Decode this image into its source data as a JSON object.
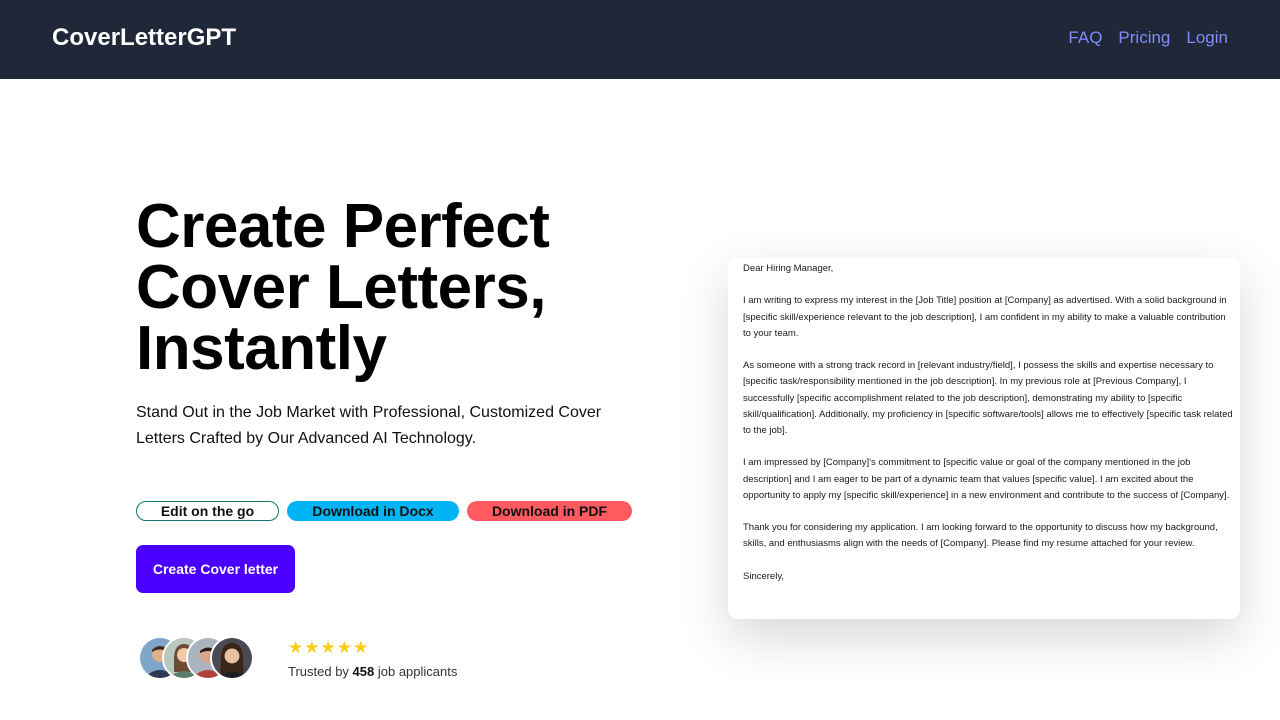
{
  "navbar": {
    "brand": "CoverLetterGPT",
    "links": [
      "FAQ",
      "Pricing",
      "Login"
    ]
  },
  "hero": {
    "title_lines": [
      "Create Perfect",
      "Cover Letters,",
      "Instantly"
    ],
    "subtitle": "Stand Out in the Job Market with Professional, Customized Cover Letters Crafted by Our Advanced AI Technology.",
    "pills": [
      "Edit on the go",
      "Download in Docx",
      "Download in PDF"
    ],
    "cta_label": "Create Cover letter",
    "rating": {
      "stars": 5,
      "trusted_prefix": "Trusted by ",
      "count": "458",
      "trusted_suffix": " job applicants"
    }
  },
  "letter": {
    "paragraphs": [
      "Dear Hiring Manager,",
      "I am writing to express my interest in the [Job Title] position at [Company] as advertised. With a solid background in [specific skill/experience relevant to the job description], I am confident in my ability to make a valuable contribution to your team.",
      "As someone with a strong track record in [relevant industry/field], I possess the skills and expertise necessary to [specific task/responsibility mentioned in the job description]. In my previous role at [Previous Company], I successfully [specific accomplishment related to the job description], demonstrating my ability to [specific skill/qualification]. Additionally, my proficiency in [specific software/tools] allows me to effectively [specific task related to the job].",
      "I am impressed by [Company]'s commitment to [specific value or goal of the company mentioned in the job description] and I am eager to be part of a dynamic team that values [specific value]. I am excited about the opportunity to apply my [specific skill/experience] in a new environment and contribute to the success of [Company].",
      "Thank you for considering my application. I am looking forward to the opportunity to discuss how my background, skills, and enthusiasms align with the needs of [Company]. Please find my resume attached for your review.",
      "Sincerely,"
    ]
  },
  "colors": {
    "navbar_bg": "#1f2739",
    "nav_link": "#818cf8",
    "cta_bg": "#4b00ff",
    "pill_edit_border": "#0f766e",
    "pill_docx": "#03b4f4",
    "pill_pdf": "#ff5a5f",
    "star": "#facc15"
  }
}
